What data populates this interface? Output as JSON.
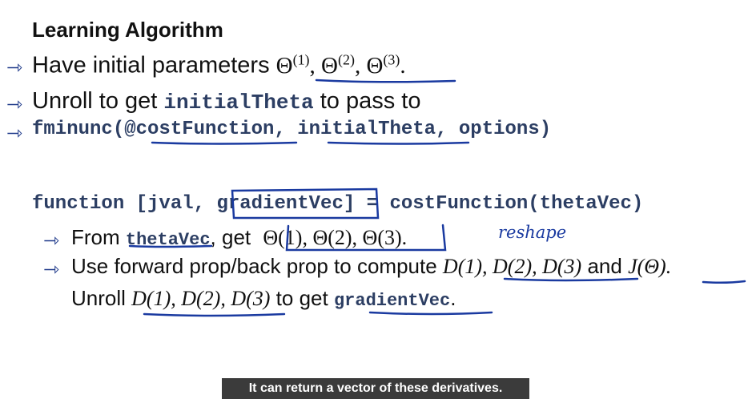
{
  "slide": {
    "title": "Learning Algorithm",
    "line1": {
      "text": "Have initial parameters",
      "math": [
        "Θ",
        "(1)",
        ", Θ",
        "(2)",
        ", Θ",
        "(3)",
        "."
      ]
    },
    "line2": {
      "pre": "Unroll to get",
      "code": "initialTheta",
      "post": "to pass to"
    },
    "line3": {
      "code": "fminunc(@costFunction, initialTheta, options)"
    },
    "line4": {
      "code": "function [jval, gradientVec] = costFunction(thetaVec)"
    },
    "line5": {
      "pre": "From",
      "code": "thetaVec",
      "mid": ",  get",
      "math": "Θ(1), Θ(2), Θ(3)."
    },
    "line6": {
      "pre": "Use forward prop/back prop to compute",
      "math": "D(1), D(2), D(3)",
      "and": "and",
      "j": "J(Θ)."
    },
    "line7": {
      "pre": "Unroll",
      "math": "D(1), D(2), D(3)",
      "mid": "to get",
      "code": "gradientVec",
      "post": "."
    }
  },
  "annotations": {
    "handwritten": "reshape"
  },
  "caption": {
    "text": "It can return a vector of these derivatives."
  },
  "colors": {
    "ink": "#1a3aa0",
    "code": "#2c3e63",
    "caption_bg": "#3b3b3b"
  }
}
